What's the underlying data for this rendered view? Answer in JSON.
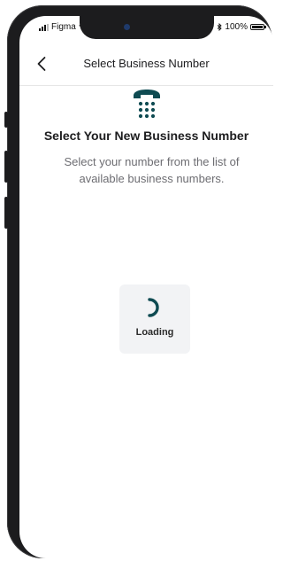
{
  "status_bar": {
    "carrier": "Figma",
    "battery": "100%",
    "battery_level": 1.0
  },
  "nav": {
    "title": "Select Business Number",
    "back_icon": "chevron-left-icon"
  },
  "header": {
    "icon": "phone-icon",
    "title": "Select Your New Business Number",
    "subtitle": "Select your number from the list of available business numbers."
  },
  "loader": {
    "label": "Loading",
    "icon": "spinner-icon"
  },
  "colors": {
    "accent": "#0f4b52",
    "text_primary": "#1d1d1f",
    "text_secondary": "#6d6d72",
    "card_bg": "#f2f3f5"
  }
}
